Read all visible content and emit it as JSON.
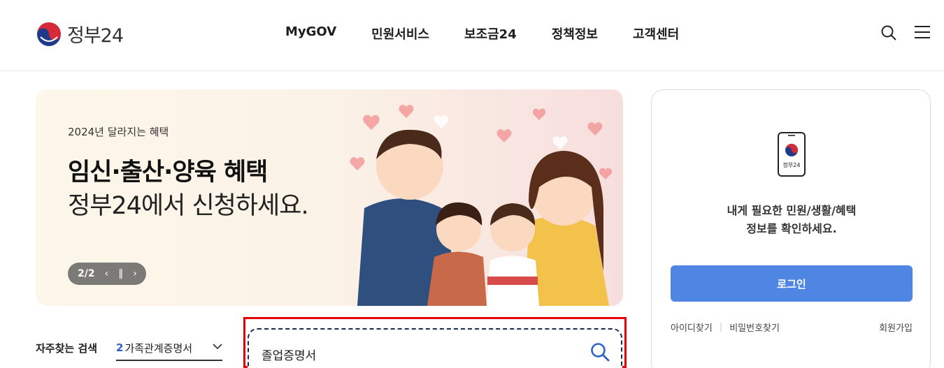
{
  "header": {
    "logo_text": "정부24",
    "nav": [
      "MyGOV",
      "민원서비스",
      "보조금24",
      "정책정보",
      "고객센터"
    ]
  },
  "banner": {
    "subtitle": "2024년 달라지는 혜택",
    "title": "임신·출산·양육 혜택",
    "description": "정부24에서 신청하세요.",
    "pager": "2/2"
  },
  "quick_search": {
    "label": "자주찾는 검색",
    "rank": "2",
    "keyword": "가족관계증명서"
  },
  "search": {
    "value": "졸업증명서"
  },
  "login": {
    "app_label": "정부24",
    "message_line1": "내게 필요한 민원/생활/혜택",
    "message_line2": "정보를 확인하세요.",
    "button": "로그인",
    "find_id": "아이디찾기",
    "find_pw": "비밀번호찾기",
    "signup": "회원가입"
  },
  "colors": {
    "brand_blue": "#4f86e4",
    "highlight_red": "#e60000",
    "rank_blue": "#2b63c9"
  },
  "icons": {
    "logo": "taegeuk-logo-icon",
    "search": "search-icon",
    "menu": "hamburger-menu-icon",
    "prev": "chevron-left-icon",
    "pause": "pause-icon",
    "next": "chevron-right-icon",
    "dropdown": "chevron-down-icon",
    "app": "mobile-phone-icon"
  }
}
